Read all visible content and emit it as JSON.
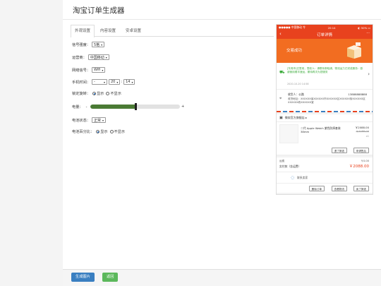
{
  "page": {
    "title": "淘宝订单生成器"
  },
  "tabs": [
    {
      "label": "外观设置",
      "active": true
    },
    {
      "label": "内容设置",
      "active": false
    },
    {
      "label": "安卓设置",
      "active": false
    }
  ],
  "form": {
    "signal_label": "信号强度：",
    "signal_value": "5格",
    "carrier_label": "运营商：",
    "carrier_value": "中国移动",
    "network_label": "网络信号：",
    "network_value": "Wifi",
    "time_label": "手机时间：",
    "time_ampm": "-",
    "time_hour": "20",
    "time_minute": "14",
    "time_sep": ":",
    "pin_label": "锁定旋转：",
    "show": "显示",
    "hide": "不显示",
    "battery_label": "电量：",
    "battery_minus": "-",
    "battery_plus": "+",
    "battery_level": 0.5,
    "charge_label": "电池状态：",
    "charge_value": "正常",
    "percent_label": "电池百分比：",
    "pin_selected": "show",
    "percent_selected": "show"
  },
  "buttons": {
    "generate": "生成图片",
    "back": "返回"
  },
  "phone": {
    "status_left": "●●●●● 中国移动 令",
    "status_time": "20:14",
    "status_right": "◐ 50% ▭",
    "nav_title": "订单详情",
    "nav_back": "‹",
    "nav_more": "···",
    "trade_status": "交易成功",
    "logistics_text": "[东莞市]已签收，签收人：请联系郭晓浦，物流运力已完成服务：感谢使用顺丰速运，期待再次为您服务",
    "logistics_time": "2020-10-20 14:58",
    "receiver": "收货人：公路",
    "receiver_phone": "13888888888",
    "address": "收货地址：XXXXXX省XXXXXX市XXXXXX区XXXXXX街XXXXXX区XXXXXX栋XXXXXX室",
    "shop_name": "微软官方旗舰店 ▸",
    "item_name": "二代 Apple Watch 紫色防摔套装 38mm",
    "item_price": "￥2088.00",
    "item_old_price": "￥2088.00",
    "item_qty": "x1",
    "refund_btn": "退了换钱",
    "apply_btn": "申请售后",
    "shipping_label": "运费",
    "shipping_value": "￥0.00",
    "paid_label": "实付款（含运费）",
    "paid_value": "￥2088.00",
    "contact": "联系卖家",
    "delete_btn": "删除订单",
    "track_btn": "查看物流",
    "buy_again_btn": "卖了换钱"
  }
}
